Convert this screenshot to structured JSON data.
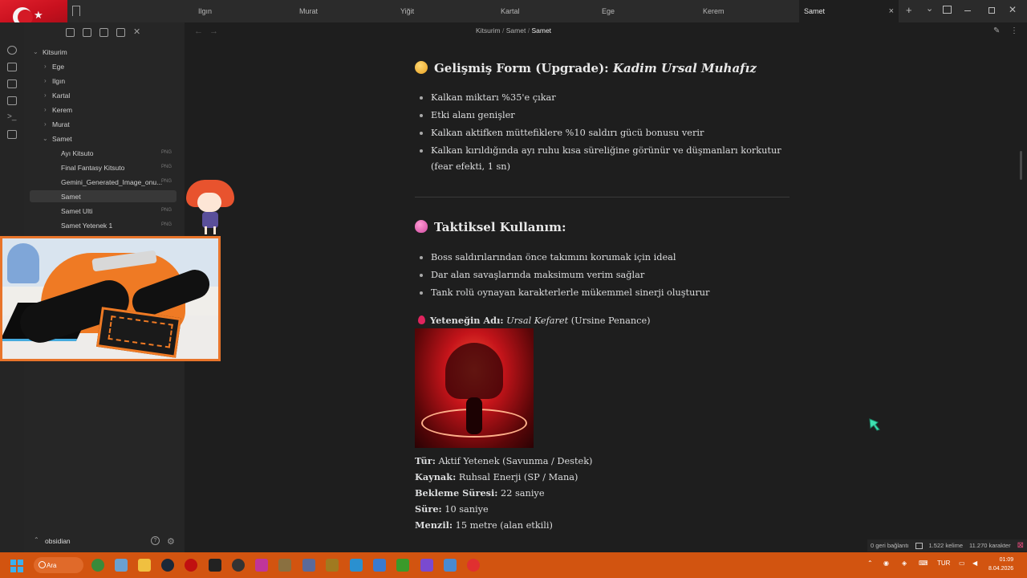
{
  "tabs": [
    "Ilgın",
    "Murat",
    "Yiğit",
    "Kartal",
    "Ege",
    "Kerem",
    "Samet"
  ],
  "active_tab": "Samet",
  "tab_close": "×",
  "new_tab": "+",
  "tab_list": "⌄",
  "breadcrumb": {
    "root": "Kitsurim",
    "sep1": "/",
    "folder": "Samet",
    "sep2": "/",
    "current": "Samet"
  },
  "sidebar": {
    "vault_root": "Kitsurim",
    "folders": [
      "Ege",
      "Ilgın",
      "Kartal",
      "Kerem",
      "Murat",
      "Samet"
    ],
    "files": [
      {
        "name": "Ayı Kitsuto",
        "tag": "PNG"
      },
      {
        "name": "Final Fantasy Kitsuto",
        "tag": "PNG"
      },
      {
        "name": "Gemini_Generated_Image_onu...",
        "tag": "PNG"
      },
      {
        "name": "Samet",
        "tag": ""
      },
      {
        "name": "Samet Ulti",
        "tag": "PNG"
      },
      {
        "name": "Samet Yetenek 1",
        "tag": "PNG"
      }
    ],
    "vault_name": "obsidian",
    "help": "?"
  },
  "note": {
    "upgrade_heading_prefix": "Gelişmiş Form (Upgrade): ",
    "upgrade_heading_name": "Kadim Ursal Muhafız",
    "upgrade_items": [
      "Kalkan miktarı %35'e çıkar",
      "Etki alanı genişler",
      "Kalkan aktifken müttefiklere %10 saldırı gücü bonusu verir",
      "Kalkan kırıldığında ayı ruhu kısa süreliğine görünür ve düşmanları korkutur",
      "(fear efekti, 1 sn)"
    ],
    "tactical_heading": "Taktiksel Kullanım:",
    "tactical_items": [
      "Boss saldırılarından önce takımını korumak için ideal",
      "Dar alan savaşlarında maksimum verim sağlar",
      "Tank rolü oynayan karakterlerle mükemmel sinerji oluşturur"
    ],
    "ability_label": "Yeteneğin Adı:",
    "ability_name": "Ursal Kefaret",
    "ability_alt": "(Ursine Penance)",
    "props": [
      {
        "k": "Tür:",
        "v": "Aktif Yetenek (Savunma / Destek)"
      },
      {
        "k": "Kaynak:",
        "v": "Ruhsal Enerji (SP / Mana)"
      },
      {
        "k": "Bekleme Süresi:",
        "v": "22 saniye"
      },
      {
        "k": "Süre:",
        "v": "10 saniye"
      },
      {
        "k": "Menzil:",
        "v": "15 metre (alan etkili)"
      }
    ]
  },
  "status": {
    "backlinks": "0 geri bağlantı",
    "words": "1.522 kelime",
    "chars": "11.270 karakter"
  },
  "taskbar": {
    "search": "Ara",
    "lang": "TUR",
    "time": "01:09",
    "date": "8.04.2026"
  },
  "colors": {
    "accent_orange": "#d25410",
    "upgrade_dot": "#f0b430",
    "tactical_dot": "#e060b0",
    "drop": "#e0245e"
  }
}
